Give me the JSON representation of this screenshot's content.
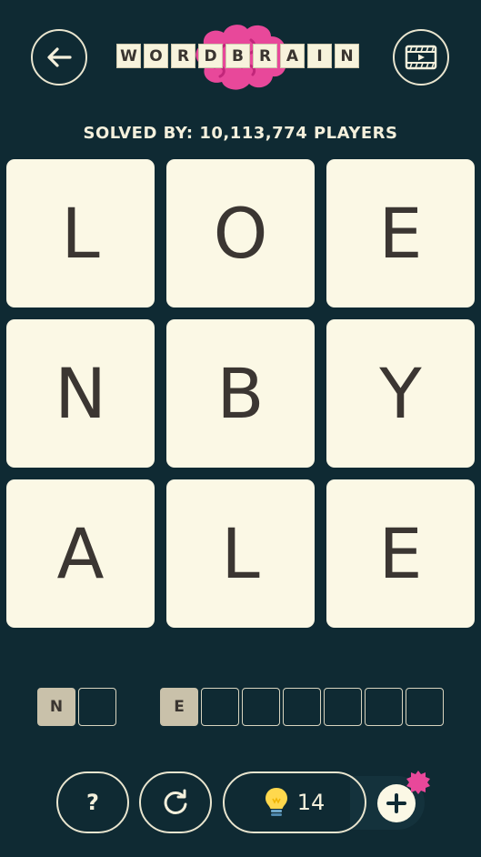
{
  "header": {
    "back_icon": "arrow-left-icon",
    "video_icon": "video-play-icon",
    "logo_letters": [
      "W",
      "O",
      "R",
      "D",
      "B",
      "R",
      "A",
      "I",
      "N"
    ],
    "logo_brain_color": "#e8489a"
  },
  "solved_text": "SOLVED BY: 10,113,774 PLAYERS",
  "board": {
    "tiles": [
      "L",
      "O",
      "E",
      "N",
      "B",
      "Y",
      "A",
      "L",
      "E"
    ]
  },
  "answers": {
    "word1": {
      "slots": 2,
      "letters": [
        "N",
        ""
      ]
    },
    "word2": {
      "slots": 7,
      "letters": [
        "E",
        "",
        "",
        "",
        "",
        "",
        ""
      ]
    }
  },
  "footer": {
    "help_label": "?",
    "restart_icon": "restart-icon",
    "hint_icon": "lightbulb-icon",
    "hint_count": "14",
    "add_icon": "plus-icon",
    "badge_color": "#e8489a"
  },
  "colors": {
    "background": "#0f2a33",
    "tile": "#fbf8e5",
    "tile_text": "#3b3632",
    "slot_filled": "#c9c1aa"
  }
}
